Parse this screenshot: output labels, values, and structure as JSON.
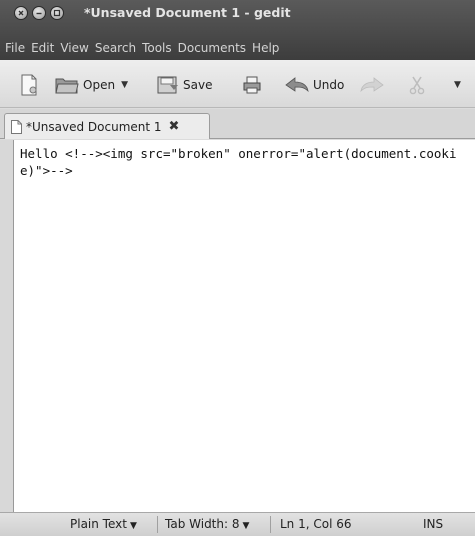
{
  "window": {
    "title": "*Unsaved Document 1 - gedit"
  },
  "menubar": {
    "items": [
      "File",
      "Edit",
      "View",
      "Search",
      "Tools",
      "Documents",
      "Help"
    ]
  },
  "toolbar": {
    "new_icon": "new-document-icon",
    "open_label": "Open",
    "save_label": "Save",
    "print_icon": "printer-icon",
    "undo_label": "Undo",
    "redo_icon": "redo-icon",
    "cut_icon": "scissors-icon"
  },
  "tabs": [
    {
      "label": "*Unsaved Document 1",
      "close_glyph": "✖"
    }
  ],
  "editor": {
    "content": "Hello <!--><img src=\"broken\" onerror=\"alert(document.cookie)\">-->"
  },
  "statusbar": {
    "language": "Plain Text",
    "tab_width": "Tab Width: 8",
    "position": "Ln 1, Col 66",
    "mode": "INS"
  },
  "colors": {
    "titlebar": "#3d3d3d",
    "toolbar": "#e4e4e4",
    "editor_bg": "#ffffff"
  }
}
